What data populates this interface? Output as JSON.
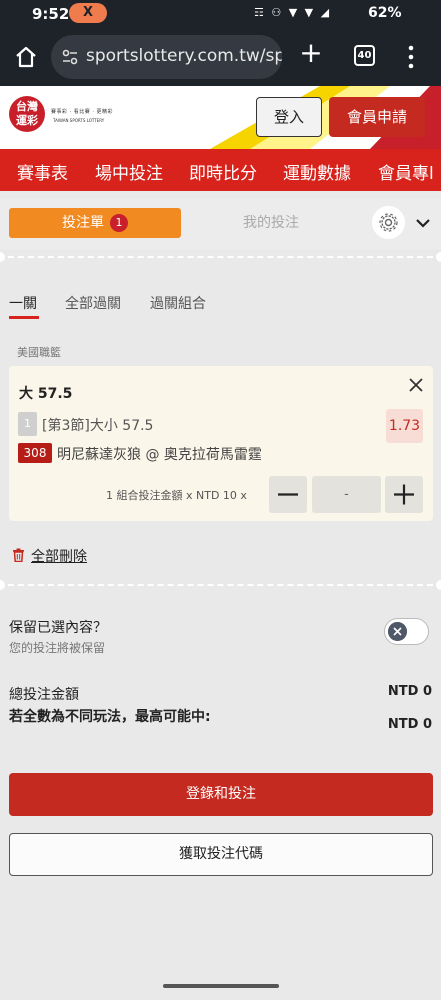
{
  "status": {
    "time": "9:52",
    "notification": "X",
    "icons": "☶ ⚇ ▼ ▼ ◢",
    "battery": "62%"
  },
  "browser": {
    "url": "sportslottery.com.tw/spc",
    "tab_count": "40"
  },
  "header": {
    "logo_text": "台灣運彩",
    "logo_tagline": "賽事彩 · 看比賽 · 更精彩",
    "logo_sub": "TAIWAN SPORTS LOTTERY",
    "login_label": "登入",
    "signup_label": "會員申請"
  },
  "nav": {
    "items": [
      {
        "label": "賽事表"
      },
      {
        "label": "場中投注"
      },
      {
        "label": "即時比分"
      },
      {
        "label": "運動數據"
      },
      {
        "label": "會員專l"
      }
    ]
  },
  "betslip": {
    "tab_betslip": "投注單",
    "tab_count": "1",
    "tab_mybets": "我的投注",
    "subtabs": [
      "一關",
      "全部過關",
      "過關組合"
    ],
    "league": "美國職籃",
    "selection": {
      "title": "大 57.5",
      "leg_number": "1",
      "market": "[第3節]大小 57.5",
      "odds": "1.73",
      "match_code": "308",
      "match": "明尼蘇達灰狼 @ 奧克拉荷馬雷霆"
    },
    "stake_label": "1 組合投注金額 x NTD 10 x",
    "stake_value": "-",
    "delete_all": "全部刪除",
    "keep_title": "保留已選內容？",
    "keep_sub": "您的投注將被保留",
    "total_label": "總投注金額",
    "total_value": "NTD 0",
    "maxwin_label": "若全數為不同玩法，最高可能中:",
    "maxwin_value": "NTD 0",
    "login_bet_label": "登錄和投注",
    "get_code_label": "獲取投注代碼"
  },
  "colors": {
    "brand_red": "#d8231d",
    "button_red": "#c42a1f",
    "accent_orange": "#f28a22",
    "highlight_yellow": "#f5d400"
  }
}
